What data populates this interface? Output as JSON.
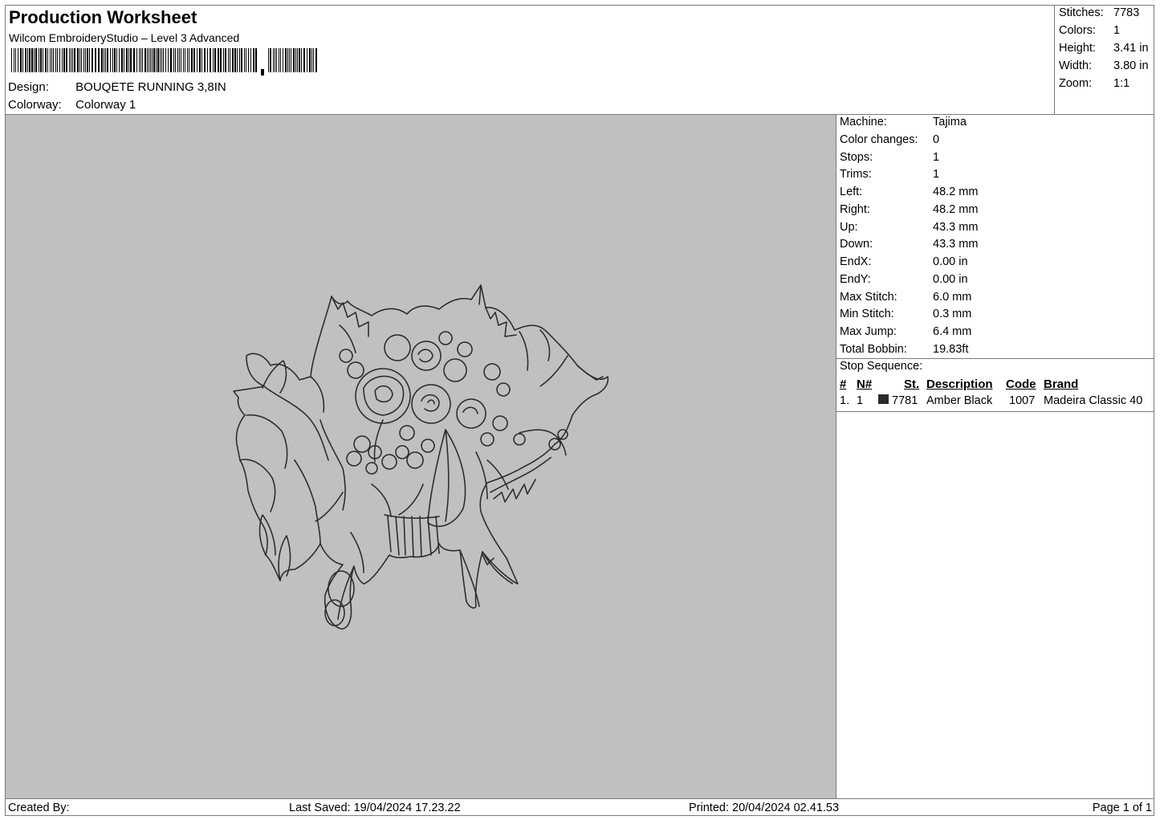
{
  "header": {
    "title": "Production Worksheet",
    "subtitle": "Wilcom EmbroideryStudio – Level 3 Advanced",
    "design_label": "Design:",
    "design_value": "BOUQETE RUNNING 3,8IN",
    "colorway_label": "Colorway:",
    "colorway_value": "Colorway 1"
  },
  "summary": {
    "items": [
      {
        "label": "Stitches:",
        "value": "7783"
      },
      {
        "label": "Colors:",
        "value": "1"
      },
      {
        "label": "Height:",
        "value": "3.41 in"
      },
      {
        "label": "Width:",
        "value": "3.80 in"
      },
      {
        "label": "Zoom:",
        "value": "1:1"
      }
    ]
  },
  "machine_info": {
    "items": [
      {
        "label": "Machine:",
        "value": "Tajima"
      },
      {
        "label": "Color changes:",
        "value": "0"
      },
      {
        "label": "Stops:",
        "value": "1"
      },
      {
        "label": "Trims:",
        "value": "1"
      },
      {
        "label": "Left:",
        "value": "48.2 mm"
      },
      {
        "label": "Right:",
        "value": "48.2 mm"
      },
      {
        "label": "Up:",
        "value": "43.3 mm"
      },
      {
        "label": "Down:",
        "value": "43.3 mm"
      },
      {
        "label": "EndX:",
        "value": "0.00 in"
      },
      {
        "label": "EndY:",
        "value": "0.00 in"
      },
      {
        "label": "Max Stitch:",
        "value": "6.0 mm"
      },
      {
        "label": "Min Stitch:",
        "value": "0.3 mm"
      },
      {
        "label": "Max Jump:",
        "value": "6.4 mm"
      },
      {
        "label": "Total Bobbin:",
        "value": "19.83ft"
      }
    ]
  },
  "stop_sequence": {
    "heading": "Stop Sequence:",
    "columns": [
      "#",
      "N#",
      "St.",
      "Description",
      "Code",
      "Brand"
    ],
    "rows": [
      {
        "index": "1.",
        "needle": "1",
        "color": "#2b2b2b",
        "stitches": "7781",
        "description": "Amber Black",
        "code": "1007",
        "brand": "Madeira Classic 40"
      }
    ]
  },
  "footer": {
    "created_by": "Created By:",
    "last_saved": "Last Saved: 19/04/2024 17.23.22",
    "printed": "Printed: 20/04/2024 02.41.53",
    "page": "Page 1 of 1"
  },
  "canvas": {
    "background": "#c0c0c0",
    "thread_color": "#2b2b2b"
  }
}
